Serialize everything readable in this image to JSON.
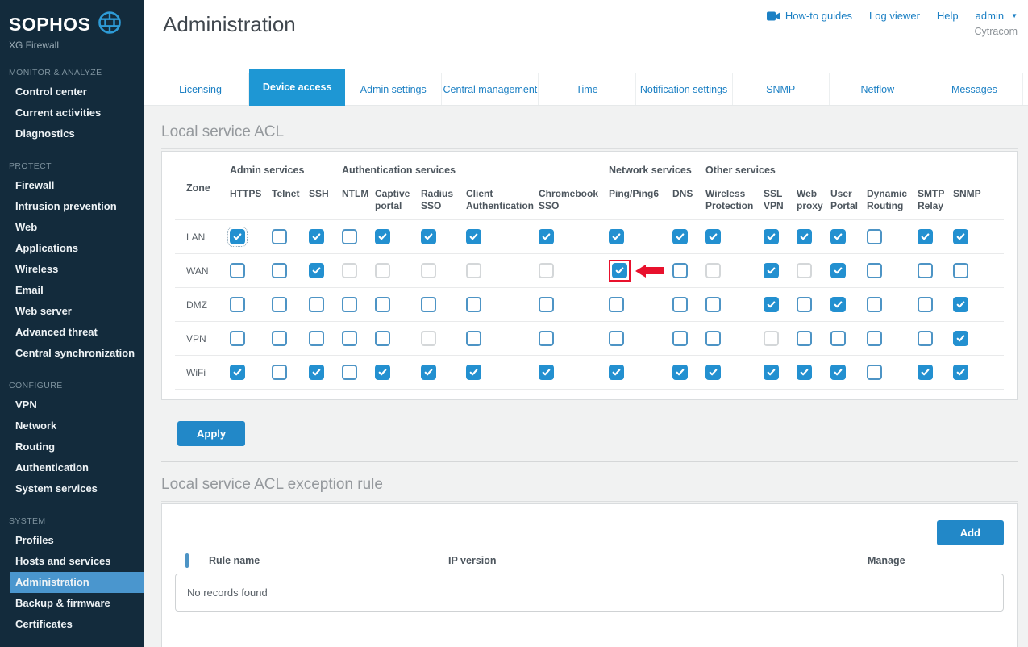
{
  "app": {
    "brand": "SOPHOS",
    "product": "XG Firewall",
    "page_title": "Administration",
    "tenant": "Cytracom"
  },
  "header": {
    "links": [
      {
        "label": "How-to guides",
        "icon": "video-camera"
      },
      {
        "label": "Log viewer"
      },
      {
        "label": "Help"
      },
      {
        "label": "admin",
        "caret": true
      }
    ]
  },
  "sidebar": {
    "sections": [
      {
        "label": "MONITOR & ANALYZE",
        "items": [
          "Control center",
          "Current activities",
          "Diagnostics"
        ]
      },
      {
        "label": "PROTECT",
        "items": [
          "Firewall",
          "Intrusion prevention",
          "Web",
          "Applications",
          "Wireless",
          "Email",
          "Web server",
          "Advanced threat",
          "Central synchronization"
        ]
      },
      {
        "label": "CONFIGURE",
        "items": [
          "VPN",
          "Network",
          "Routing",
          "Authentication",
          "System services"
        ]
      },
      {
        "label": "SYSTEM",
        "items": [
          "Profiles",
          "Hosts and services",
          "Administration",
          "Backup & firmware",
          "Certificates"
        ]
      }
    ],
    "active_item": "Administration"
  },
  "tabs": {
    "items": [
      "Licensing",
      "Device access",
      "Admin settings",
      "Central management",
      "Time",
      "Notification settings",
      "SNMP",
      "Netflow",
      "Messages"
    ],
    "active": "Device access"
  },
  "acl": {
    "heading": "Local service ACL",
    "zone_label": "Zone",
    "groups": [
      {
        "label": "Admin services",
        "span": 3
      },
      {
        "label": "Authentication services",
        "span": 5
      },
      {
        "label": "Network services",
        "span": 2
      },
      {
        "label": "Other services",
        "span": 7
      }
    ],
    "columns": [
      "HTTPS",
      "Telnet",
      "SSH",
      "NTLM",
      "Captive portal",
      "Radius SSO",
      "Client Authentication",
      "Chromebook SSO",
      "Ping/Ping6",
      "DNS",
      "Wireless Protection",
      "SSL VPN",
      "Web proxy",
      "User Portal",
      "Dynamic Routing",
      "SMTP Relay",
      "SNMP"
    ],
    "rows": [
      {
        "zone": "LAN",
        "cells": [
          "checked-focus",
          "unchecked",
          "checked",
          "unchecked",
          "checked",
          "checked",
          "checked",
          "checked",
          "checked",
          "checked",
          "checked",
          "checked",
          "checked",
          "checked",
          "unchecked",
          "checked",
          "checked"
        ]
      },
      {
        "zone": "WAN",
        "cells": [
          "unchecked",
          "unchecked",
          "checked",
          "disabled",
          "disabled",
          "disabled",
          "disabled",
          "disabled",
          "checked-highlight",
          "unchecked",
          "disabled",
          "checked",
          "disabled",
          "checked",
          "unchecked",
          "unchecked",
          "unchecked"
        ]
      },
      {
        "zone": "DMZ",
        "cells": [
          "unchecked",
          "unchecked",
          "unchecked",
          "unchecked",
          "unchecked",
          "unchecked",
          "unchecked",
          "unchecked",
          "unchecked",
          "unchecked",
          "unchecked",
          "checked",
          "unchecked",
          "checked",
          "unchecked",
          "unchecked",
          "checked"
        ]
      },
      {
        "zone": "VPN",
        "cells": [
          "unchecked",
          "unchecked",
          "unchecked",
          "unchecked",
          "unchecked",
          "disabled",
          "unchecked",
          "unchecked",
          "unchecked",
          "unchecked",
          "unchecked",
          "disabled",
          "unchecked",
          "unchecked",
          "unchecked",
          "unchecked",
          "checked"
        ]
      },
      {
        "zone": "WiFi",
        "cells": [
          "checked",
          "unchecked",
          "checked",
          "unchecked",
          "checked",
          "checked",
          "checked",
          "checked",
          "checked",
          "checked",
          "checked",
          "checked",
          "checked",
          "checked",
          "unchecked",
          "checked",
          "checked"
        ]
      }
    ],
    "apply_label": "Apply"
  },
  "exception": {
    "heading": "Local service ACL exception rule",
    "add_label": "Add",
    "columns": [
      "Rule name",
      "IP version",
      "Manage"
    ],
    "empty_text": "No records found"
  },
  "colors": {
    "sidebar_bg": "#132B3C",
    "sidebar_active": "#4A96CE",
    "link": "#1C80C4",
    "tab_active": "#1E97D4",
    "cb_blue": "#2390D0",
    "btn_blue": "#2288C8",
    "red": "#E8112D"
  }
}
